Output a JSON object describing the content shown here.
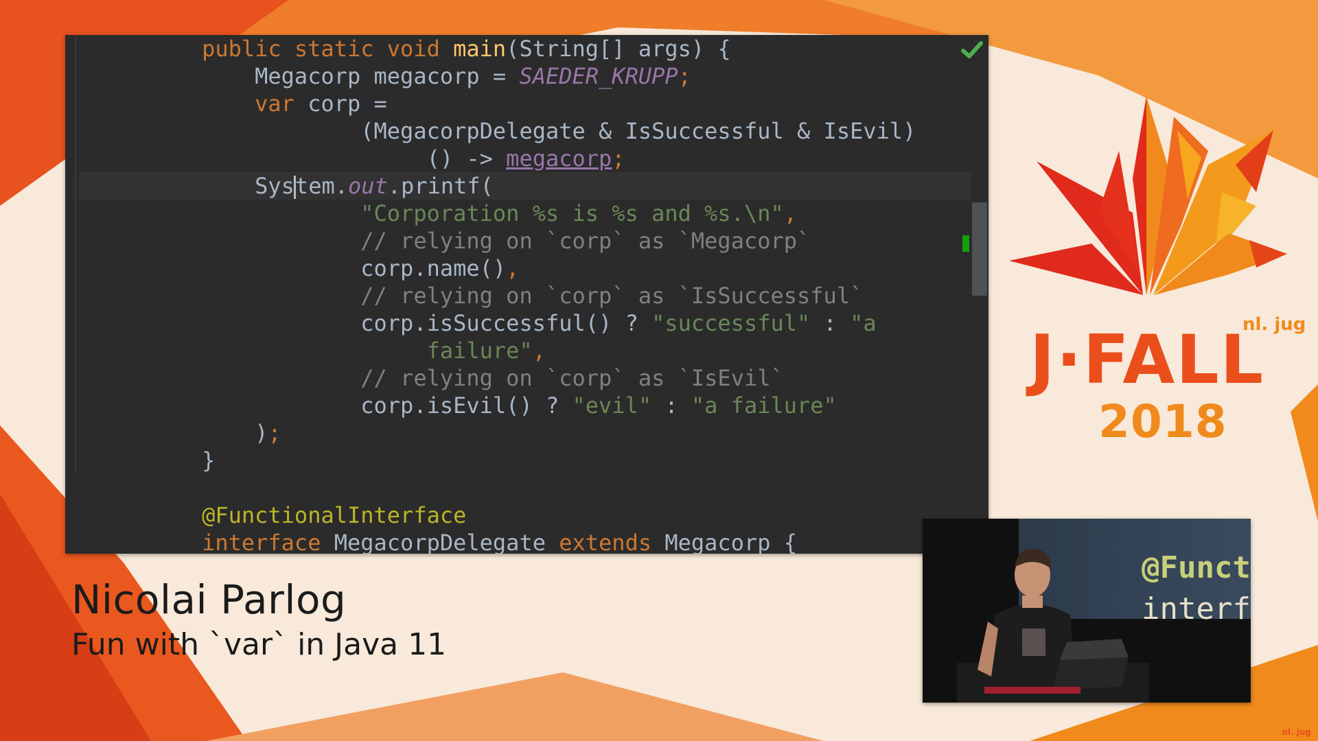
{
  "code_lines": [
    [
      {
        "t": "    "
      },
      {
        "t": "public static void ",
        "c": "kw"
      },
      {
        "t": "main",
        "c": "fn"
      },
      {
        "t": "(String[] args) {"
      }
    ],
    [
      {
        "t": "        Megacorp megacorp = "
      },
      {
        "t": "SAEDER_KRUPP",
        "c": "cst"
      },
      {
        "t": ";",
        "c": "sym"
      }
    ],
    [
      {
        "t": "        "
      },
      {
        "t": "var ",
        "c": "kw"
      },
      {
        "t": "corp ="
      }
    ],
    [
      {
        "t": "                (MegacorpDelegate & IsSuccessful & IsEvil)"
      }
    ],
    [
      {
        "t": "                     () -> "
      },
      {
        "t": "megacorp",
        "c": "und"
      },
      {
        "t": ";",
        "c": "sym"
      }
    ],
    [
      {
        "t": "        Sys"
      },
      {
        "caret": true
      },
      {
        "t": "tem."
      },
      {
        "t": "out",
        "c": "fld"
      },
      {
        "t": ".printf("
      }
    ],
    [
      {
        "t": "                "
      },
      {
        "t": "\"Corporation %s is %s and %s.\\n\"",
        "c": "str"
      },
      {
        "t": ",",
        "c": "sym"
      }
    ],
    [
      {
        "t": "                "
      },
      {
        "t": "// relying on `corp` as `Megacorp`",
        "c": "cmt"
      }
    ],
    [
      {
        "t": "                corp.name()"
      },
      {
        "t": ",",
        "c": "sym"
      }
    ],
    [
      {
        "t": "                "
      },
      {
        "t": "// relying on `corp` as `IsSuccessful`",
        "c": "cmt"
      }
    ],
    [
      {
        "t": "                corp.isSuccessful() ? "
      },
      {
        "t": "\"successful\"",
        "c": "str"
      },
      {
        "t": " : "
      },
      {
        "t": "\"a",
        "c": "str"
      }
    ],
    [
      {
        "t": "                     "
      },
      {
        "t": "failure\"",
        "c": "str"
      },
      {
        "t": ",",
        "c": "sym"
      }
    ],
    [
      {
        "t": "                "
      },
      {
        "t": "// relying on `corp` as `IsEvil`",
        "c": "cmt"
      }
    ],
    [
      {
        "t": "                corp.isEvil() ? "
      },
      {
        "t": "\"evil\"",
        "c": "str"
      },
      {
        "t": " : "
      },
      {
        "t": "\"a failure\"",
        "c": "str"
      }
    ],
    [
      {
        "t": "        )"
      },
      {
        "t": ";",
        "c": "sym"
      }
    ],
    [
      {
        "t": "    }"
      }
    ],
    [],
    [
      {
        "t": "    "
      },
      {
        "t": "@FunctionalInterface",
        "c": "ann"
      }
    ],
    [
      {
        "t": "    "
      },
      {
        "t": "interface ",
        "c": "kw"
      },
      {
        "t": "MegacorpDelegate "
      },
      {
        "t": "extends ",
        "c": "kw"
      },
      {
        "t": "Megacorp {"
      }
    ]
  ],
  "editor": {
    "status_icon": "check-icon",
    "status_color": "#4caf50"
  },
  "speaker": {
    "name": "Nicolai Parlog",
    "talk_title": "Fun with `var` in Java 11"
  },
  "logo": {
    "wordmark": "J·FALL",
    "suffix": "nl. jug",
    "year": "2018",
    "primary_color": "#ea4e1b",
    "secondary_color": "#f08a1c"
  },
  "camera": {
    "screen_line1": "@Funct",
    "screen_line2": "interf"
  },
  "corner_logo": "nl. jug"
}
